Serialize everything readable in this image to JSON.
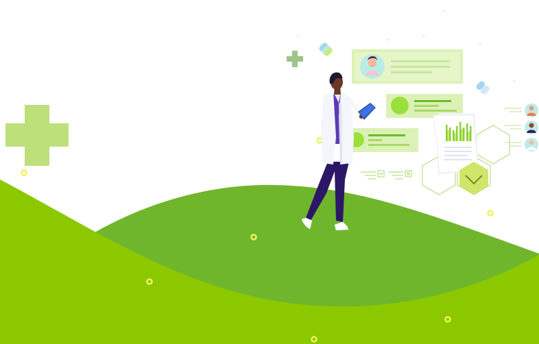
{
  "scene": {
    "colors": {
      "background": "#ffffff",
      "hill_back": "#70b62c",
      "hill_front": "#8bc800",
      "cross": "#bde07b",
      "cross_small": "#9cc589",
      "card_bg": "#d9f0b0",
      "card_line": "#a9d86a",
      "accent": "#9be03a",
      "coat": "#f4f6fb",
      "trousers": "#2b1766",
      "skin": "#6b3a25",
      "hair": "#1e1836",
      "clipboard": "#2c55b8",
      "hex_line": "#b8de8a",
      "dot_ring": "#f0f35e",
      "pill_blue": "#a8d6f0",
      "pill_green": "#c7ee6a"
    },
    "icons": [
      "large-plus-cross-icon",
      "small-plus-cross-icon",
      "doctor-figure",
      "clipboard-icon",
      "profile-card-icon",
      "info-card-icon",
      "chart-document-icon",
      "hexagon-check-icon",
      "pill-capsule-icon",
      "avatar-icon"
    ]
  }
}
